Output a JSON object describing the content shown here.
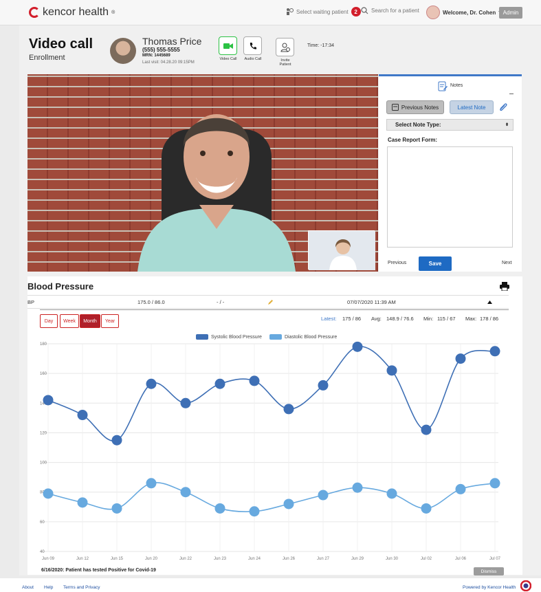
{
  "app": {
    "brand": "kencor health",
    "waiting_patient": "Select waiting patient",
    "waiting_count": "2",
    "search_placeholder": "Search for a patient",
    "welcome": "Welcome, Dr. Cohen",
    "admin": "Admin"
  },
  "page": {
    "title": "Video call",
    "subtitle": "Enrollment"
  },
  "patient": {
    "name": "Thomas Price",
    "phone": "(555) 555-5555",
    "mrn": "MRN: 1445689",
    "last_visit": "Last visit: 04.28.20 09:15PM"
  },
  "call": {
    "video_label": "Video Call",
    "audio_label": "Audio Call",
    "invite_label_1": "Invite",
    "invite_label_2": "Patient",
    "time": "Time: -17:34"
  },
  "notes": {
    "title": "Notes",
    "previous_notes": "Previous Notes",
    "latest_note": "Latest Note",
    "select_note_type": "Select Note Type:",
    "crf_label": "Case Report Form:",
    "previous": "Previous",
    "save": "Save",
    "next": "Next"
  },
  "bp": {
    "title": "Blood Pressure",
    "label": "BP",
    "value": "175.0 / 86.0",
    "secondary": "- / -",
    "datetime": "07/07/2020 11:39 AM",
    "ranges": [
      "Day",
      "Week",
      "Month",
      "Year"
    ],
    "active_range": "Month",
    "latest_label": "Latest:",
    "latest_value": "175 / 86",
    "avg_label": "Avg:",
    "avg_value": "148.9 / 76.6",
    "min_label": "Min:",
    "min_value": "115 / 67",
    "max_label": "Max:",
    "max_value": "178 / 86"
  },
  "chart_data": {
    "type": "line",
    "categories": [
      "Jun 09",
      "Jun 12",
      "Jun 15",
      "Jun 20",
      "Jun 22",
      "Jun 23",
      "Jun 24",
      "Jun 26",
      "Jun 27",
      "Jun 29",
      "Jun 30",
      "Jul 02",
      "Jul 06",
      "Jul 07"
    ],
    "series": [
      {
        "name": "Systolic Blood Pressure",
        "color": "#3e6fb5",
        "values": [
          142,
          132,
          115,
          153,
          140,
          153,
          155,
          136,
          152,
          178,
          162,
          122,
          170,
          175
        ]
      },
      {
        "name": "Diastolic Blood Pressure",
        "color": "#67a9df",
        "values": [
          79,
          73,
          69,
          86,
          80,
          69,
          67,
          72,
          78,
          83,
          79,
          69,
          82,
          86
        ]
      }
    ],
    "yticks": [
      40,
      60,
      80,
      100,
      120,
      140,
      160,
      180
    ],
    "ylim": [
      40,
      180
    ]
  },
  "alert": {
    "text": "6/16/2020: Patient has tested Positive for Covid-19",
    "dismiss": "Dismiss"
  },
  "footer": {
    "about": "About",
    "help": "Help",
    "terms": "Terms and Privacy",
    "powered": "Powered by Kencor Health"
  }
}
